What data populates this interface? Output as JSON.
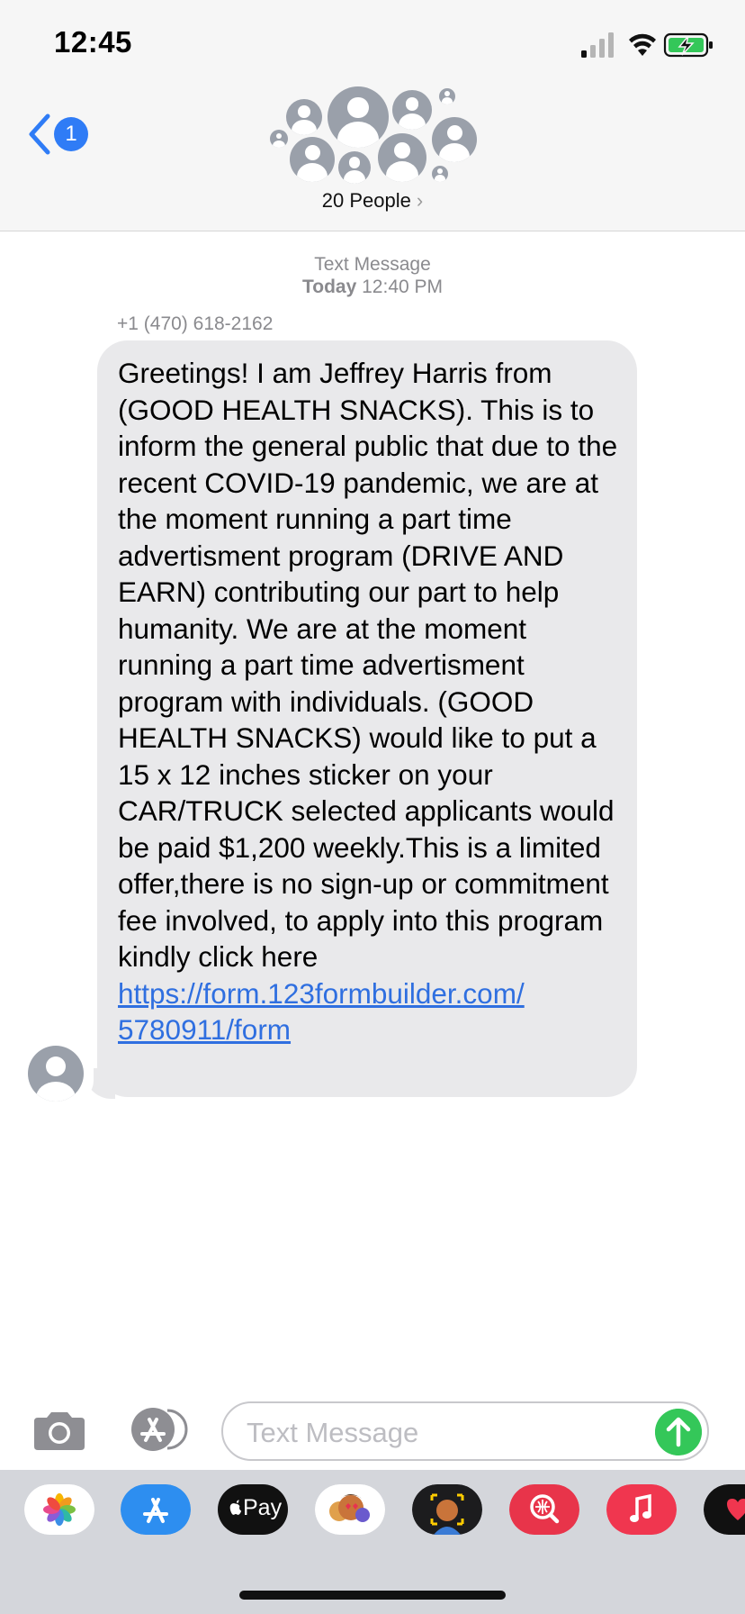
{
  "status_bar": {
    "time": "12:45"
  },
  "header": {
    "back_badge": "1",
    "group_name": "20 People",
    "chevron": "›"
  },
  "thread": {
    "meta_title": "Text Message",
    "meta_day": "Today",
    "meta_time": "12:40 PM",
    "sender": "+1 (470) 618-2162",
    "message_body": "Greetings! I am Jeffrey Harris from (GOOD HEALTH SNACKS). This is to inform the general public that due to the recent COVID-19 pandemic, we are at the moment running a part time advertisment program (DRIVE AND EARN) contributing our part to help humanity. We are at the moment running a part time advertisment program with individuals. (GOOD HEALTH SNACKS) would like to put a 15 x 12 inches sticker on your CAR/TRUCK selected applicants would be paid $1,200 weekly.This is a limited offer,there is no sign-up or commitment fee involved, to apply into this program kindly click here",
    "message_link": "https://form.123formbuilder.com/\n5780911/form"
  },
  "composer": {
    "placeholder": "Text Message"
  },
  "app_drawer": {
    "apple_pay_label": "Pay",
    "items": [
      "photos-app-icon",
      "app-store-app-icon",
      "apple-pay-app-icon",
      "memoji-stickers-icon",
      "memoji-icon",
      "images-search-icon",
      "music-app-icon",
      "digital-touch-icon"
    ]
  },
  "colors": {
    "accent_blue": "#2f7cf6",
    "send_green": "#34c759",
    "bubble_gray": "#e9e9eb",
    "battery_green": "#34c759"
  }
}
